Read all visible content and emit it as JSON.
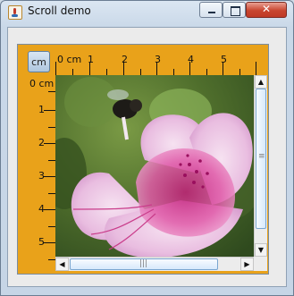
{
  "window": {
    "title": "Scroll demo",
    "controls": {
      "minimize_icon": "minimize-icon",
      "maximize_icon": "maximize-icon",
      "close_icon": "close-icon",
      "close_glyph": "✕"
    }
  },
  "rulers": {
    "unit_button": "cm",
    "horizontal": {
      "origin": "0 cm",
      "ticks": [
        "1",
        "2",
        "3",
        "4",
        "5"
      ]
    },
    "vertical": {
      "origin": "0 cm",
      "ticks": [
        "1",
        "2",
        "3",
        "4",
        "5"
      ]
    },
    "color": "#e9a21a"
  },
  "scrollbars": {
    "vertical": {
      "up_glyph": "▲",
      "down_glyph": "▼",
      "grip": "≡",
      "position": 0.0
    },
    "horizontal": {
      "left_glyph": "◀",
      "right_glyph": "▶",
      "grip": "|||",
      "position": 0.0
    }
  },
  "image": {
    "subject": "pink azalea flower with a bee"
  }
}
